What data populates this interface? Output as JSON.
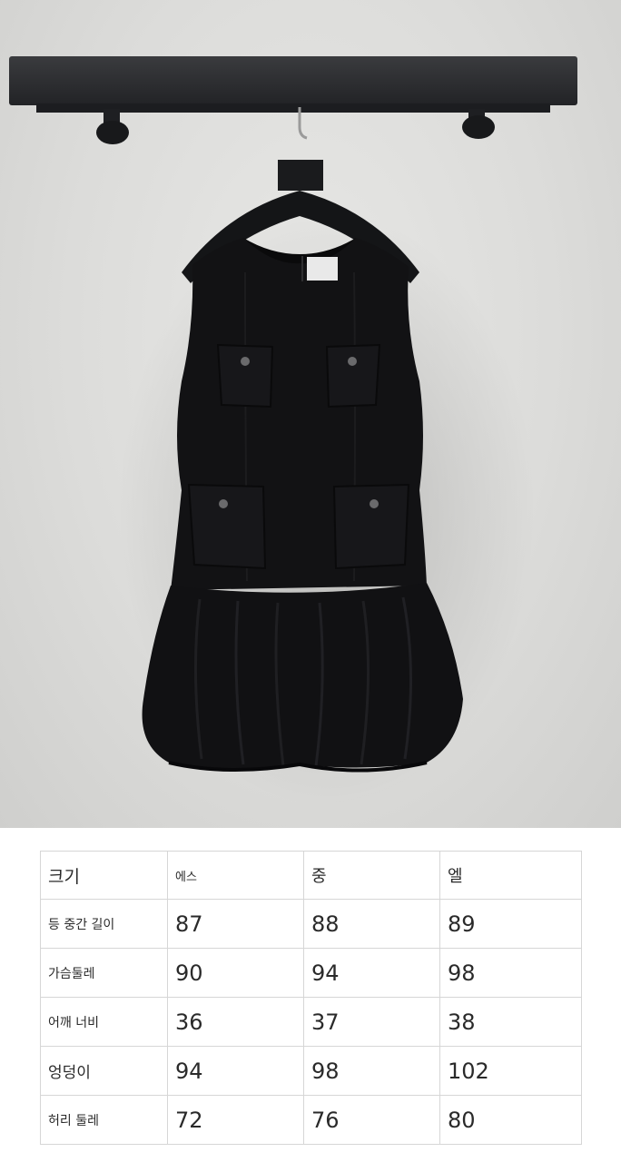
{
  "photo": {
    "subject": "dress-photo",
    "colors": {
      "wall": "#dcdcda",
      "dress": "#121214",
      "rack": "#2b2c2f"
    }
  },
  "size_table": {
    "title": "크기",
    "sizes": [
      "에스",
      "중",
      "엘"
    ],
    "rows": [
      {
        "label": "등 중간 길이",
        "values": [
          "87",
          "88",
          "89"
        ]
      },
      {
        "label": "가슴둘레",
        "values": [
          "90",
          "94",
          "98"
        ]
      },
      {
        "label": "어깨 너비",
        "values": [
          "36",
          "37",
          "38"
        ]
      },
      {
        "label": "엉덩이",
        "values": [
          "94",
          "98",
          "102"
        ]
      },
      {
        "label": "허리 둘레",
        "values": [
          "72",
          "76",
          "80"
        ]
      }
    ]
  }
}
